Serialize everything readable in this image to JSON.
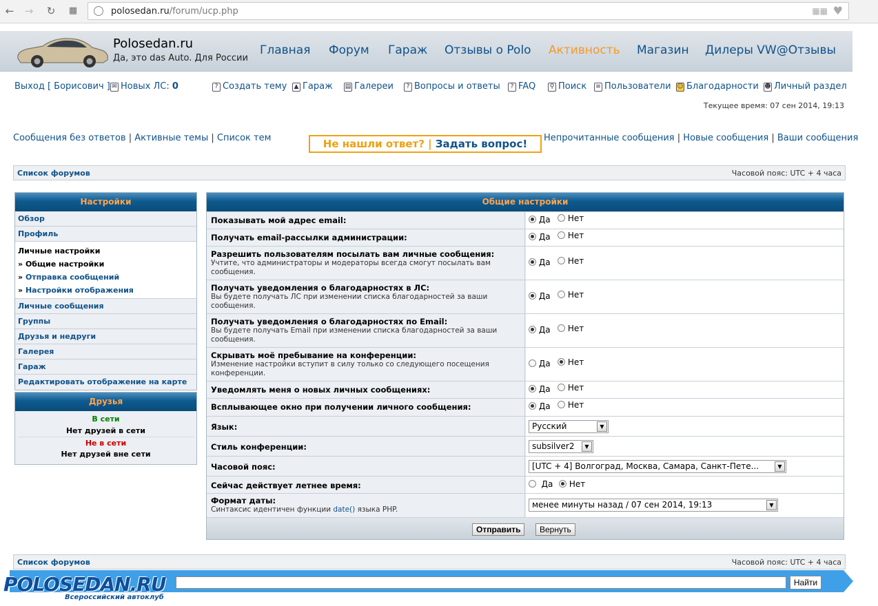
{
  "browser": {
    "url_host": "polosedan.ru",
    "url_path": "/forum/ucp.php"
  },
  "header": {
    "site_title": "Polosedan.ru",
    "site_subtitle": "Да, это das Auto. Для России",
    "nav": [
      "Главная",
      "Форум",
      "Гараж",
      "Отзывы о Polo",
      "Активность",
      "Магазин",
      "Дилеры VW@Отзывы"
    ],
    "nav_active": "Активность"
  },
  "userbar": {
    "logout": "Выход [ Борисович ]",
    "new_pm_label": "Новых ЛС:",
    "new_pm_count": "0",
    "links": [
      "Создать тему",
      "Гараж",
      "Галереи",
      "Вопросы и ответы",
      "FAQ",
      "Поиск",
      "Пользователи",
      "Благодарности",
      "Личный раздел"
    ],
    "current_time": "Текущее время: 07 сен 2014, 19:13"
  },
  "quicklinks": {
    "left": [
      "Сообщения без ответов",
      "Активные темы",
      "Список тем"
    ],
    "right": [
      "Непрочитанные сообщения",
      "Новые сообщения",
      "Ваши сообщения"
    ],
    "ask_part1": "Не нашли ответ? |",
    "ask_part2": "Задать вопрос!"
  },
  "breadcrumb": {
    "forum_index": "Список форумов",
    "timezone": "Часовой пояс: UTC + 4 часа"
  },
  "sidebar": {
    "title": "Настройки",
    "items_top": [
      "Обзор",
      "Профиль"
    ],
    "section_label": "Личные настройки",
    "sub_items": [
      {
        "label": "Общие настройки",
        "active": true
      },
      {
        "label": "Отправка сообщений",
        "active": false
      },
      {
        "label": "Настройки отображения",
        "active": false
      }
    ],
    "items_bottom": [
      "Личные сообщения",
      "Группы",
      "Друзья и недруги",
      "Галерея",
      "Гараж",
      "Редактировать отображение на карте"
    ]
  },
  "friends": {
    "title": "Друзья",
    "online_label": "В сети",
    "online_empty": "Нет друзей в сети",
    "offline_label": "Не в сети",
    "offline_empty": "Нет друзей вне сети",
    "online_color": "#008000",
    "offline_color": "#cc0000"
  },
  "settings": {
    "title": "Общие настройки",
    "yes": "Да",
    "no": "Нет",
    "rows": [
      {
        "label": "Показывать мой адрес email:",
        "hint": "",
        "value": "yes"
      },
      {
        "label": "Получать email-рассылки администрации:",
        "hint": "",
        "value": "yes"
      },
      {
        "label": "Разрешить пользователям посылать вам личные сообщения:",
        "hint": "Учтите, что администраторы и модераторы всегда смогут посылать вам сообщения.",
        "value": "yes"
      },
      {
        "label": "Получать уведомления о благодарностях в ЛС:",
        "hint": "Вы будете получать ЛС при изменении списка благодарностей за ваши сообщения.",
        "value": "yes"
      },
      {
        "label": "Получать уведомления о благодарностях по Email:",
        "hint": "Вы будете получать Email при изменении списка благодарностей за ваши сообщения.",
        "value": "yes"
      },
      {
        "label": "Скрывать моё пребывание на конференции:",
        "hint": "Изменение настройки вступит в силу только со следующего посещения конференции.",
        "value": "no"
      },
      {
        "label": "Уведомлять меня о новых личных сообщениях:",
        "hint": "",
        "value": "yes"
      },
      {
        "label": "Всплывающее окно при получении личного сообщения:",
        "hint": "",
        "value": "yes"
      }
    ],
    "language_label": "Язык:",
    "language_value": "Русский",
    "style_label": "Стиль конференции:",
    "style_value": "subsilver2",
    "tz_label": "Часовой пояс:",
    "tz_value": "[UTC + 4] Волгоград, Москва, Самара, Санкт-Пете...",
    "dst_label": "Сейчас действует летнее время:",
    "dst_value": "no",
    "date_label": "Формат даты:",
    "date_hint_pre": "Синтаксис идентичен функции",
    "date_hint_link": "date()",
    "date_hint_post": "языка PHP.",
    "date_value": "менее минуты назад / 07 сен 2014, 19:13",
    "submit": "Отправить",
    "reset": "Вернуть"
  },
  "footer": {
    "logo": "POLOSEDAN.RU",
    "slogan": "Всероссийский автоклуб",
    "search_button": "Найти"
  },
  "colors": {
    "link": "#105289",
    "accent_orange": "#ffa34f",
    "ask_orange": "#f0a010"
  }
}
